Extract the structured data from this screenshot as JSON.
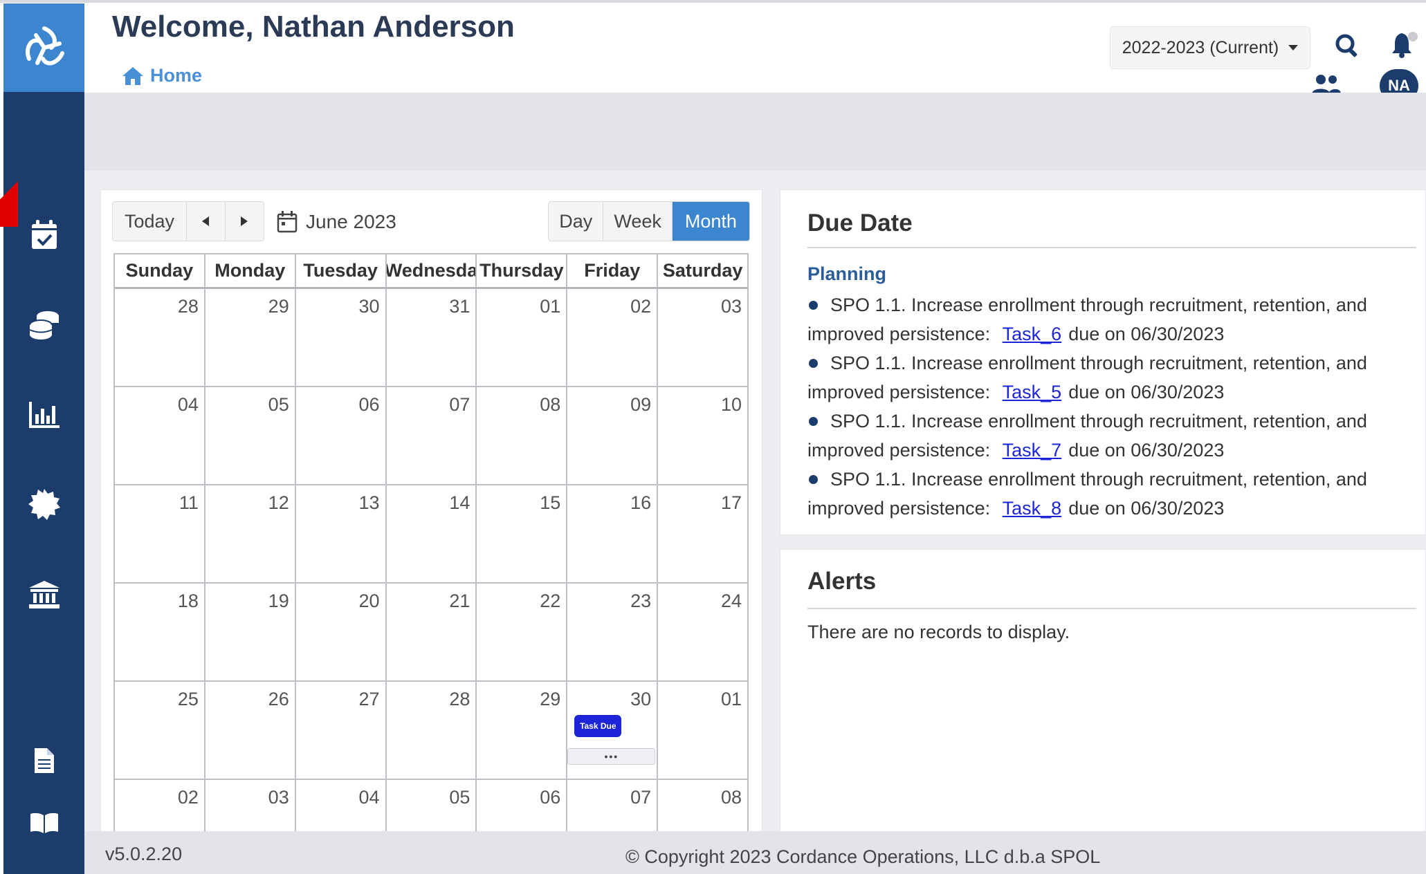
{
  "header": {
    "welcome": "Welcome, Nathan Anderson",
    "breadcrumb_home": "Home",
    "year_selector": "2022-2023 (Current)",
    "avatar_initials": "NA"
  },
  "sidebar": {
    "items": [
      {
        "icon": "calendar-check-icon"
      },
      {
        "icon": "coins-stack-icon"
      },
      {
        "icon": "bar-chart-icon"
      },
      {
        "icon": "settings-badge-icon"
      },
      {
        "icon": "institution-icon"
      },
      {
        "icon": "document-icon"
      },
      {
        "icon": "book-icon"
      }
    ]
  },
  "calendar": {
    "today_label": "Today",
    "title": "June 2023",
    "views": [
      "Day",
      "Week",
      "Month"
    ],
    "active_view": "Month",
    "weekdays": [
      "Sunday",
      "Monday",
      "Tuesday",
      "Wednesda",
      "Thursday",
      "Friday",
      "Saturday"
    ],
    "weeks": [
      [
        "28",
        "29",
        "30",
        "31",
        "01",
        "02",
        "03"
      ],
      [
        "04",
        "05",
        "06",
        "07",
        "08",
        "09",
        "10"
      ],
      [
        "11",
        "12",
        "13",
        "14",
        "15",
        "16",
        "17"
      ],
      [
        "18",
        "19",
        "20",
        "21",
        "22",
        "23",
        "24"
      ],
      [
        "25",
        "26",
        "27",
        "28",
        "29",
        "30",
        "01"
      ],
      [
        "02",
        "03",
        "04",
        "05",
        "06",
        "07",
        "08"
      ]
    ],
    "event_label": "Task Due",
    "more_label": "•••"
  },
  "due_date": {
    "title": "Due Date",
    "category": "Planning",
    "items": [
      {
        "text": "SPO 1.1. Increase enrollment through recruitment, retention, and improved persistence:",
        "task": "Task_6",
        "due": "due on 06/30/2023"
      },
      {
        "text": "SPO 1.1. Increase enrollment through recruitment, retention, and improved persistence:",
        "task": "Task_5",
        "due": "due on 06/30/2023"
      },
      {
        "text": "SPO 1.1. Increase enrollment through recruitment, retention, and improved persistence:",
        "task": "Task_7",
        "due": "due on 06/30/2023"
      },
      {
        "text": "SPO 1.1. Increase enrollment through recruitment, retention, and improved persistence:",
        "task": "Task_8",
        "due": "due on 06/30/2023"
      }
    ]
  },
  "alerts": {
    "title": "Alerts",
    "empty_text": "There are no records to display."
  },
  "footer": {
    "version": "v5.0.2.20",
    "copyright": "© Copyright 2023 Cordance Operations, LLC d.b.a SPOL"
  },
  "colors": {
    "sidebar": "#1c3c6b",
    "accent": "#3c86d0",
    "event": "#1d25d9"
  }
}
